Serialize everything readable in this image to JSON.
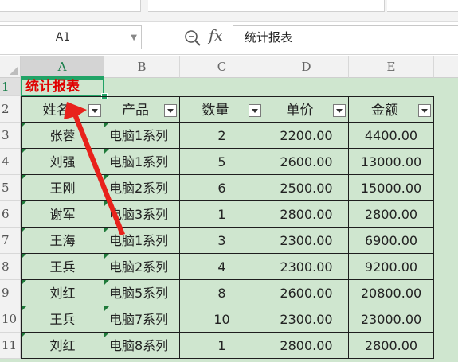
{
  "name_box": {
    "value": "A1"
  },
  "formula": {
    "value": "统计报表"
  },
  "columns": [
    "A",
    "B",
    "C",
    "D",
    "E"
  ],
  "rows": [
    "1",
    "2",
    "3",
    "4",
    "5",
    "6",
    "7",
    "8",
    "9",
    "10",
    "11"
  ],
  "title_cell": "统计报表",
  "headers": [
    "姓名",
    "产品",
    "数量",
    "单价",
    "金额"
  ],
  "data": [
    [
      "张蓉",
      "电脑1系列",
      "2",
      "2200.00",
      "4400.00"
    ],
    [
      "刘强",
      "电脑1系列",
      "5",
      "2600.00",
      "13000.00"
    ],
    [
      "王刚",
      "电脑2系列",
      "6",
      "2500.00",
      "15000.00"
    ],
    [
      "谢军",
      "电脑3系列",
      "1",
      "2800.00",
      "2800.00"
    ],
    [
      "王海",
      "电脑1系列",
      "3",
      "2300.00",
      "6900.00"
    ],
    [
      "王兵",
      "电脑2系列",
      "4",
      "2300.00",
      "9200.00"
    ],
    [
      "刘红",
      "电脑5系列",
      "8",
      "2600.00",
      "20800.00"
    ],
    [
      "王兵",
      "电脑7系列",
      "10",
      "2300.00",
      "23000.00"
    ],
    [
      "刘红",
      "电脑8系列",
      "1",
      "2800.00",
      "2800.00"
    ]
  ],
  "colors": {
    "accent": "#21a366",
    "title": "#e00000",
    "sheet_bg": "#cfe6cf",
    "arrow": "#e8221c"
  },
  "icons": {
    "zoom": "zoom-in-icon",
    "fx": "function-icon",
    "filter": "filter-dropdown-icon"
  }
}
